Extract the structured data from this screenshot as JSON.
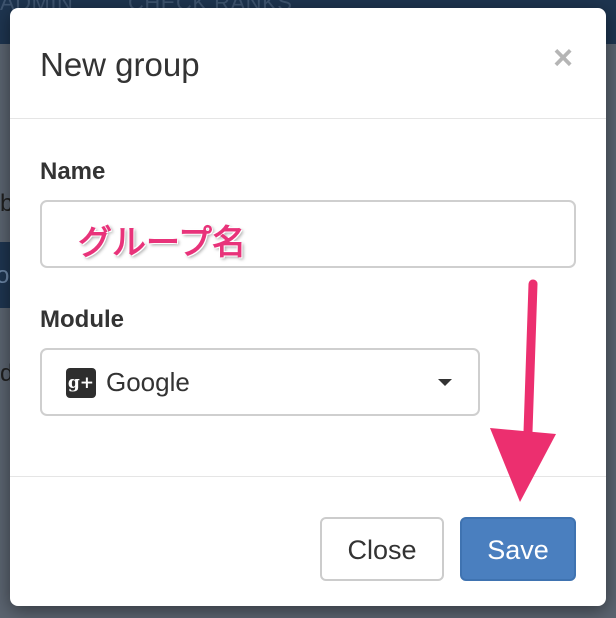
{
  "background": {
    "nav_items": [
      "ADMIN",
      "CHECK RANKS"
    ],
    "left_fragments": [
      "b",
      "o",
      "d"
    ]
  },
  "modal": {
    "title": "New group",
    "close_symbol": "×",
    "name_label": "Name",
    "name_value": "グループ名",
    "module_label": "Module",
    "module_selected": "Google",
    "module_icon": "google-plus-icon",
    "buttons": {
      "close": "Close",
      "save": "Save"
    }
  },
  "colors": {
    "primary_button": "#4a7fbf",
    "annotation_arrow": "#ec2f6f",
    "annotation_text": "#e8337a"
  }
}
